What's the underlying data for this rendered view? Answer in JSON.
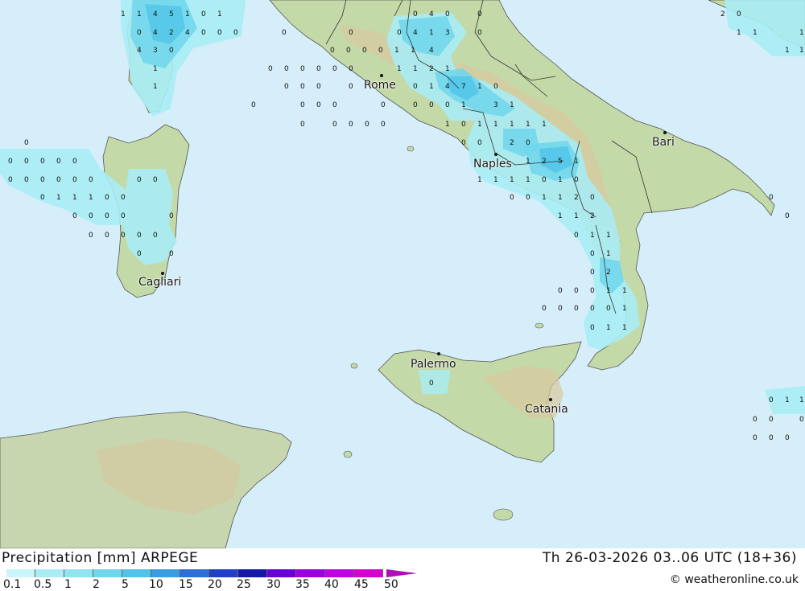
{
  "map": {
    "cities": [
      {
        "name": "Rome"
      },
      {
        "name": "Naples"
      },
      {
        "name": "Bari"
      },
      {
        "name": "Cagliari"
      },
      {
        "name": "Palermo"
      },
      {
        "name": "Catania"
      }
    ],
    "colors": {
      "sea": "#d6eef9",
      "land": "#c4d9a8",
      "hills": "#d8c9a0",
      "precip_light": "#a9ecf4",
      "precip_mid": "#7fdcef",
      "precip_heavy": "#4cb5e8"
    }
  },
  "footer": {
    "title": "Precipitation [mm] ARPEGE",
    "timestamp": "Th 26-03-2026 03..06 UTC (18+36)",
    "credit": "© weatheronline.co.uk"
  },
  "legend": {
    "ticks": [
      "0.1",
      "0.5",
      "1",
      "2",
      "5",
      "10",
      "15",
      "20",
      "25",
      "30",
      "35",
      "40",
      "45",
      "50"
    ],
    "colors": [
      "#c8f4fb",
      "#a9ecf4",
      "#8fe4f0",
      "#6fd6ec",
      "#4fc3e8",
      "#3a9ee0",
      "#2c6fd8",
      "#1f3fc8",
      "#1418a8",
      "#6a00d8",
      "#9a00e0",
      "#c200e6",
      "#d800d0",
      "#b00cba"
    ]
  }
}
